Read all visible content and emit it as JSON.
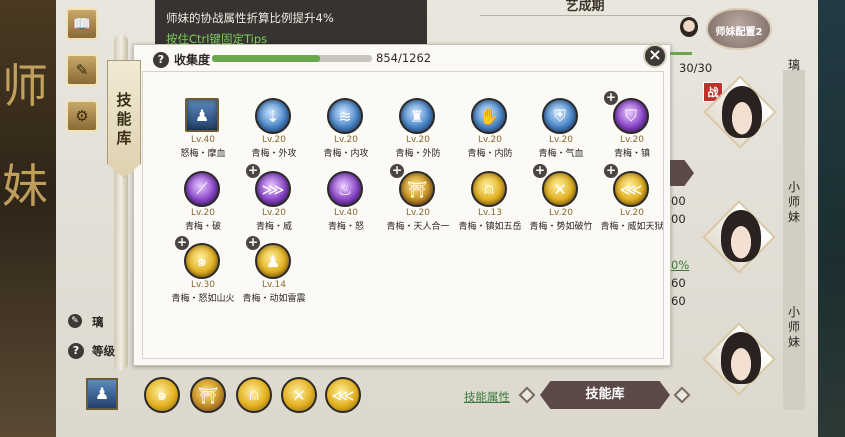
{
  "tooltip": {
    "line1": "师妹的协战属性折算比例提升4%",
    "line2": "按住Ctrl键固定Tips"
  },
  "stage": {
    "title": "艺成期"
  },
  "dialog": {
    "tab_label": "技能库",
    "collection_label": "收集度",
    "collection_value": "854/1262",
    "collection_fraction": 0.677,
    "close_label": "×",
    "help_icon_label": "?"
  },
  "skills": [
    {
      "level": "Lv.40",
      "name": "怒梅・摩血",
      "icon": "portrait-skill-icon",
      "color": "portrait",
      "square": true,
      "plus": false
    },
    {
      "level": "Lv.20",
      "name": "青梅・外攻",
      "icon": "strike-icon",
      "color": "blue",
      "square": false,
      "plus": false
    },
    {
      "level": "Lv.20",
      "name": "青梅・内攻",
      "icon": "wave-icon",
      "color": "blue",
      "square": false,
      "plus": false
    },
    {
      "level": "Lv.20",
      "name": "青梅・外防",
      "icon": "mask-icon",
      "color": "blue",
      "square": false,
      "plus": false
    },
    {
      "level": "Lv.20",
      "name": "青梅・内防",
      "icon": "hand-icon",
      "color": "blue",
      "square": false,
      "plus": false
    },
    {
      "level": "Lv.20",
      "name": "青梅・气血",
      "icon": "armor-icon",
      "color": "blue",
      "square": false,
      "plus": false
    },
    {
      "level": "Lv.20",
      "name": "青梅・镇",
      "icon": "shield-icon",
      "color": "purple",
      "square": false,
      "plus": true
    },
    {
      "level": "Lv.20",
      "name": "青梅・破",
      "icon": "blade-icon",
      "color": "purple",
      "square": false,
      "plus": false
    },
    {
      "level": "Lv.20",
      "name": "青梅・威",
      "icon": "claw-icon",
      "color": "purple",
      "square": false,
      "plus": true
    },
    {
      "level": "Lv.40",
      "name": "青梅・怒",
      "icon": "flame-icon",
      "color": "purple",
      "square": false,
      "plus": false
    },
    {
      "level": "Lv.20",
      "name": "青梅・天人合一",
      "icon": "gate-icon",
      "color": "red",
      "square": false,
      "plus": true
    },
    {
      "level": "Lv.13",
      "name": "青梅・镇如五岳",
      "icon": "bell-icon",
      "color": "gold",
      "square": false,
      "plus": false
    },
    {
      "level": "Lv.20",
      "name": "青梅・势如破竹",
      "icon": "spears-icon",
      "color": "gold",
      "square": false,
      "plus": true
    },
    {
      "level": "Lv.20",
      "name": "青梅・威如天狱",
      "icon": "claw-gold-icon",
      "color": "gold",
      "square": false,
      "plus": true
    },
    {
      "level": "Lv.30",
      "name": "青梅・怒如山火",
      "icon": "fire-swirl-icon",
      "color": "gold",
      "square": false,
      "plus": true
    },
    {
      "level": "Lv.14",
      "name": "青梅・动如雷震",
      "icon": "runner-icon",
      "color": "gold",
      "square": false,
      "plus": true
    }
  ],
  "glyphs": {
    "portrait-skill-icon": "♟",
    "strike-icon": "⇣",
    "wave-icon": "≋",
    "mask-icon": "♜",
    "hand-icon": "✋",
    "armor-icon": "⛨",
    "shield-icon": "⛉",
    "blade-icon": "⟋",
    "claw-icon": "⋙",
    "flame-icon": "♨",
    "gate-icon": "⛩",
    "bell-icon": "⍝",
    "spears-icon": "✕",
    "claw-gold-icon": "⋘",
    "fire-swirl-icon": "๑",
    "runner-icon": "♟"
  },
  "bottom_bar": {
    "slots": [
      "fire-swirl-icon",
      "gate-icon",
      "bell-icon",
      "spears-icon",
      "claw-gold-icon"
    ],
    "skill_attr_link": "技能属性",
    "skill_lib_button": "技能库"
  },
  "left_panel": {
    "name_fragment": "璃",
    "level_fragment": "等级",
    "calligraphy": [
      "师",
      "妹"
    ]
  },
  "right_panel": {
    "config_label": "师妹配置2",
    "battle_badge": "战",
    "count": "30/30",
    "active_name": "璃",
    "members": [
      {
        "name": "小师妹"
      },
      {
        "name": "小师妹"
      }
    ]
  },
  "background_fragments": {
    "a": "00",
    "b": "00",
    "c": "0%",
    "d": "60",
    "e": "60"
  }
}
